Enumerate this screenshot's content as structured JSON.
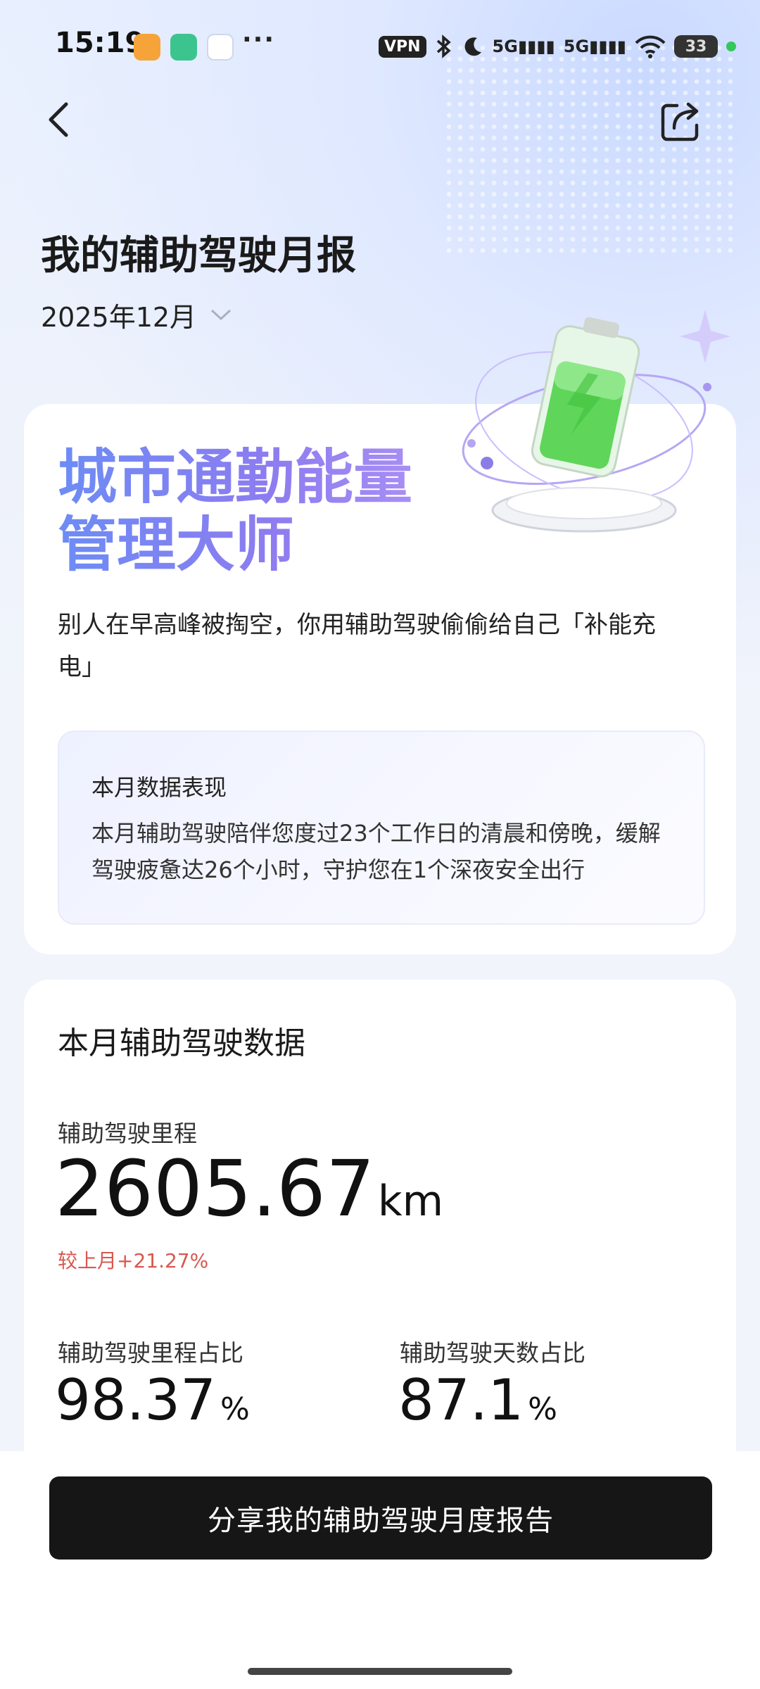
{
  "status_bar": {
    "time": "15:19",
    "vpn": "VPN",
    "network1": "5G",
    "network2": "5G",
    "battery": "33",
    "more": "···"
  },
  "header": {
    "title": "我的辅助驾驶月报",
    "month": "2025年12月"
  },
  "summary_card": {
    "headline_line1": "城市通勤能量",
    "headline_line2": "管理大师",
    "subtitle": "别人在早高峰被掏空，你用辅助驾驶偷偷给自己「补能充电」",
    "box_title": "本月数据表现",
    "box_text": "本月辅助驾驶陪伴您度过23个工作日的清晨和傍晚，缓解驾驶疲惫达26个小时，守护您在1个深夜安全出行"
  },
  "data_card": {
    "title": "本月辅助驾驶数据",
    "mileage_label": "辅助驾驶里程",
    "mileage_value": "2605.67",
    "mileage_unit": "km",
    "mileage_delta": "较上月+21.27%",
    "mileage_ratio_label": "辅助驾驶里程占比",
    "mileage_ratio_value": "98.37",
    "days_ratio_label": "辅助驾驶天数占比",
    "days_ratio_value": "87.1",
    "percent_unit": "%"
  },
  "cta": {
    "label": "分享我的辅助驾驶月度报告"
  },
  "colors": {
    "accent_gradient_start": "#6d8cf5",
    "accent_gradient_end": "#a88ef5",
    "delta_red": "#d8584f",
    "cta_bg": "#161616",
    "battery_green": "#4cd64c"
  }
}
